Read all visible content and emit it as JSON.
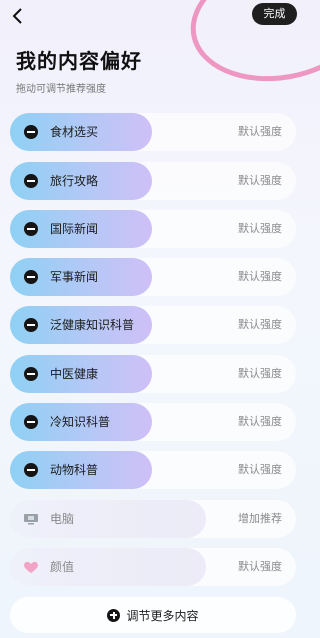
{
  "header": {
    "done_label": "完成",
    "title": "我的内容偏好",
    "subtitle": "拖动可调节推荐强度"
  },
  "interests": [
    {
      "label": "食材选买",
      "level": "默认强度",
      "active": true
    },
    {
      "label": "旅行攻略",
      "level": "默认强度",
      "active": true
    },
    {
      "label": "国际新闻",
      "level": "默认强度",
      "active": true
    },
    {
      "label": "军事新闻",
      "level": "默认强度",
      "active": true
    },
    {
      "label": "泛健康知识科普",
      "level": "默认强度",
      "active": true
    },
    {
      "label": "中医健康",
      "level": "默认强度",
      "active": true
    },
    {
      "label": "冷知识科普",
      "level": "默认强度",
      "active": true
    },
    {
      "label": "动物科普",
      "level": "默认强度",
      "active": true
    }
  ],
  "extra": [
    {
      "label": "电脑",
      "level": "增加推荐",
      "icon": "computer-icon"
    },
    {
      "label": "颜值",
      "level": "默认强度",
      "icon": "heart-icon"
    }
  ],
  "more_button": {
    "label": "调节更多内容"
  },
  "colors": {
    "accent_start": "#8fd0f4",
    "accent_end": "#cfc0f7",
    "decor": "#eb78af"
  }
}
